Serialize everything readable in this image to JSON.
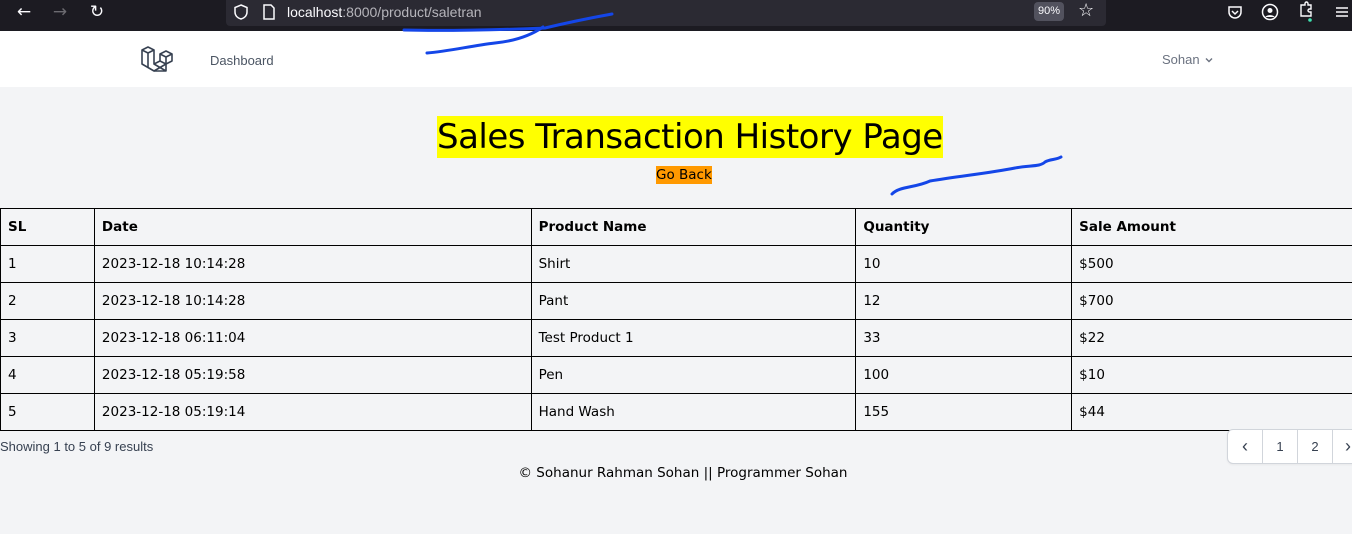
{
  "browser": {
    "url_host": "localhost",
    "url_path": ":8000/product/saletran",
    "zoom": "90%"
  },
  "navbar": {
    "dashboard_label": "Dashboard",
    "user_name": "Sohan"
  },
  "main": {
    "title": "Sales Transaction History Page",
    "go_back_label": "Go Back"
  },
  "table": {
    "headers": [
      "SL",
      "Date",
      "Product Name",
      "Quantity",
      "Sale Amount"
    ],
    "rows": [
      [
        "1",
        "2023-12-18 10:14:28",
        "Shirt",
        "10",
        "$500"
      ],
      [
        "2",
        "2023-12-18 10:14:28",
        "Pant",
        "12",
        "$700"
      ],
      [
        "3",
        "2023-12-18 06:11:04",
        "Test Product 1",
        "33",
        "$22"
      ],
      [
        "4",
        "2023-12-18 05:19:58",
        "Pen",
        "100",
        "$10"
      ],
      [
        "5",
        "2023-12-18 05:19:14",
        "Hand Wash",
        "155",
        "$44"
      ]
    ]
  },
  "pagination": {
    "showing_text": "Showing 1 to 5 of 9 results",
    "prev_glyph": "‹",
    "pages": [
      "1",
      "2"
    ],
    "next_glyph": "›"
  },
  "footer": {
    "text": "© Sohanur Rahman Sohan || Programmer Sohan"
  },
  "colors": {
    "title_highlight": "#ffff00",
    "go_back_bg": "#ff9900",
    "annotation_stroke": "#1446e8"
  }
}
